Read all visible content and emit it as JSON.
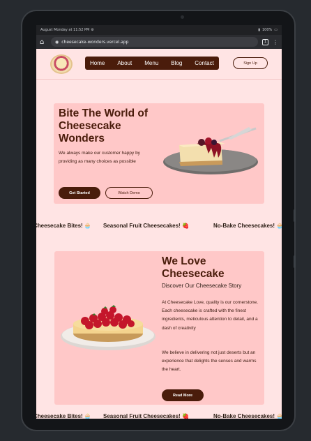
{
  "status": {
    "time": "August Monday at 11:52 PM",
    "battery": "100%"
  },
  "browser": {
    "url": "cheesecake-wonders.vercel.app"
  },
  "nav": {
    "links": [
      "Home",
      "About",
      "Menu",
      "Blog",
      "Contact"
    ],
    "signup": "Sign Up"
  },
  "hero": {
    "title": "Bite The World of Cheesecake Wonders",
    "text": "We always make our customer happy by providing as many choices as possible",
    "get_started": "Get Started",
    "watch_demo": "Watch Demo"
  },
  "marquee": {
    "items": [
      "Cheesecake Bites! 🧁",
      "Seasonal Fruit Cheesecakes! 🍓",
      "No-Bake Cheesecakes! 🧁"
    ]
  },
  "about": {
    "title": "We Love Cheesecake",
    "subtitle": "Discover Our Cheesecake Story",
    "para1": "At Cheesecake Love, quality is our cornerstone. Each cheesecake is crafted with the finest ingredients, meticulous attention to detail, and a dash of creativity",
    "para2": "We believe in delivering not just deserts but an experience that delights the senses and warms the heart.",
    "read_more": "Read More"
  },
  "colors": {
    "brand": "#4a1c0b",
    "card": "#ffc8c8",
    "page": "#ffe4e4"
  }
}
